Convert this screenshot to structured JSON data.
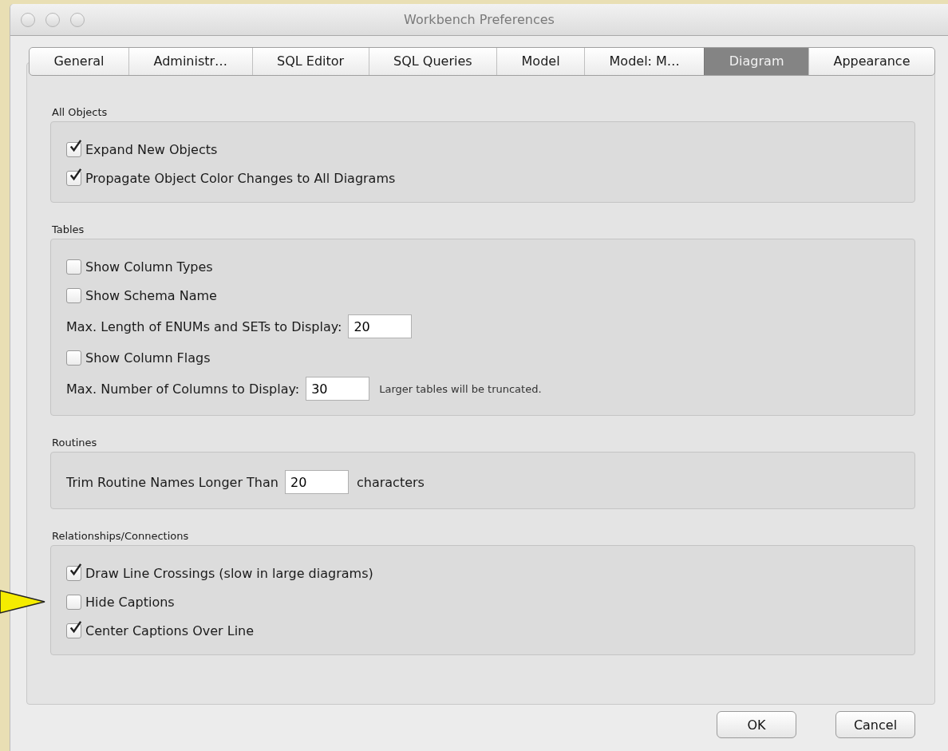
{
  "window": {
    "title": "Workbench Preferences"
  },
  "tabs": [
    {
      "label": "General",
      "selected": false
    },
    {
      "label": "Administr…",
      "selected": false
    },
    {
      "label": "SQL Editor",
      "selected": false
    },
    {
      "label": "SQL Queries",
      "selected": false
    },
    {
      "label": "Model",
      "selected": false
    },
    {
      "label": "Model: M…",
      "selected": false
    },
    {
      "label": "Diagram",
      "selected": true
    },
    {
      "label": "Appearance",
      "selected": false
    }
  ],
  "groups": [
    {
      "title": "All Objects",
      "rows": [
        {
          "kind": "checkbox",
          "label": "Expand New Objects",
          "checked": true
        },
        {
          "kind": "checkbox",
          "label": "Propagate Object Color Changes to All Diagrams",
          "checked": true
        }
      ]
    },
    {
      "title": "Tables",
      "rows": [
        {
          "kind": "checkbox",
          "label": "Show Column Types",
          "checked": false
        },
        {
          "kind": "checkbox",
          "label": "Show Schema Name",
          "checked": false
        },
        {
          "kind": "input",
          "label": "Max. Length of ENUMs and SETs to Display:",
          "value": "20"
        },
        {
          "kind": "checkbox",
          "label": "Show Column Flags",
          "checked": false
        },
        {
          "kind": "input",
          "label": "Max. Number of Columns to Display:",
          "value": "30",
          "note": "Larger tables will be truncated."
        }
      ]
    },
    {
      "title": "Routines",
      "rows": [
        {
          "kind": "input",
          "label": "Trim Routine Names Longer Than",
          "value": "20",
          "suffix": "characters"
        }
      ]
    },
    {
      "title": "Relationships/Connections",
      "rows": [
        {
          "kind": "checkbox",
          "label": "Draw Line Crossings (slow in large diagrams)",
          "checked": true
        },
        {
          "kind": "checkbox",
          "label": "Hide Captions",
          "checked": false
        },
        {
          "kind": "checkbox",
          "label": "Center Captions Over Line",
          "checked": true
        }
      ]
    }
  ],
  "buttons": [
    {
      "label": "OK"
    },
    {
      "label": "Cancel"
    }
  ]
}
